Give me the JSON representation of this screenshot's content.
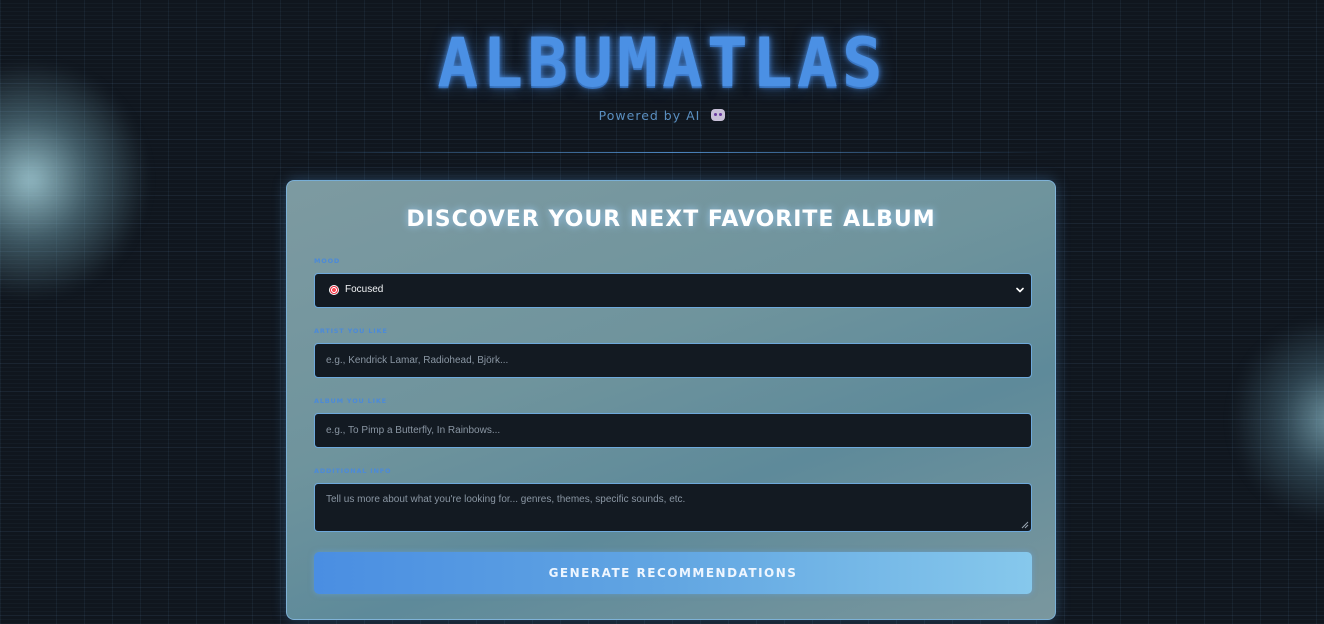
{
  "header": {
    "logo_text": "ALBUMATLAS",
    "subtitle": "Powered by AI"
  },
  "form": {
    "title": "DISCOVER YOUR NEXT FAVORITE ALBUM",
    "mood": {
      "label": "MOOD",
      "selected_value": "Focused",
      "icon": "target-icon"
    },
    "artist": {
      "label": "ARTIST YOU LIKE",
      "placeholder": "e.g., Kendrick Lamar, Radiohead, Björk..."
    },
    "album": {
      "label": "ALBUM YOU LIKE",
      "placeholder": "e.g., To Pimp a Butterfly, In Rainbows..."
    },
    "additional": {
      "label": "ADDITIONAL INFO",
      "placeholder": "Tell us more about what you're looking for... genres, themes, specific sounds, etc."
    },
    "submit_label": "GENERATE RECOMMENDATIONS"
  },
  "colors": {
    "accent": "#4b90e4",
    "card": "#6f949d",
    "field_bg": "#131a22",
    "button_start": "#4a8ee2",
    "button_end": "#86c8ec"
  }
}
